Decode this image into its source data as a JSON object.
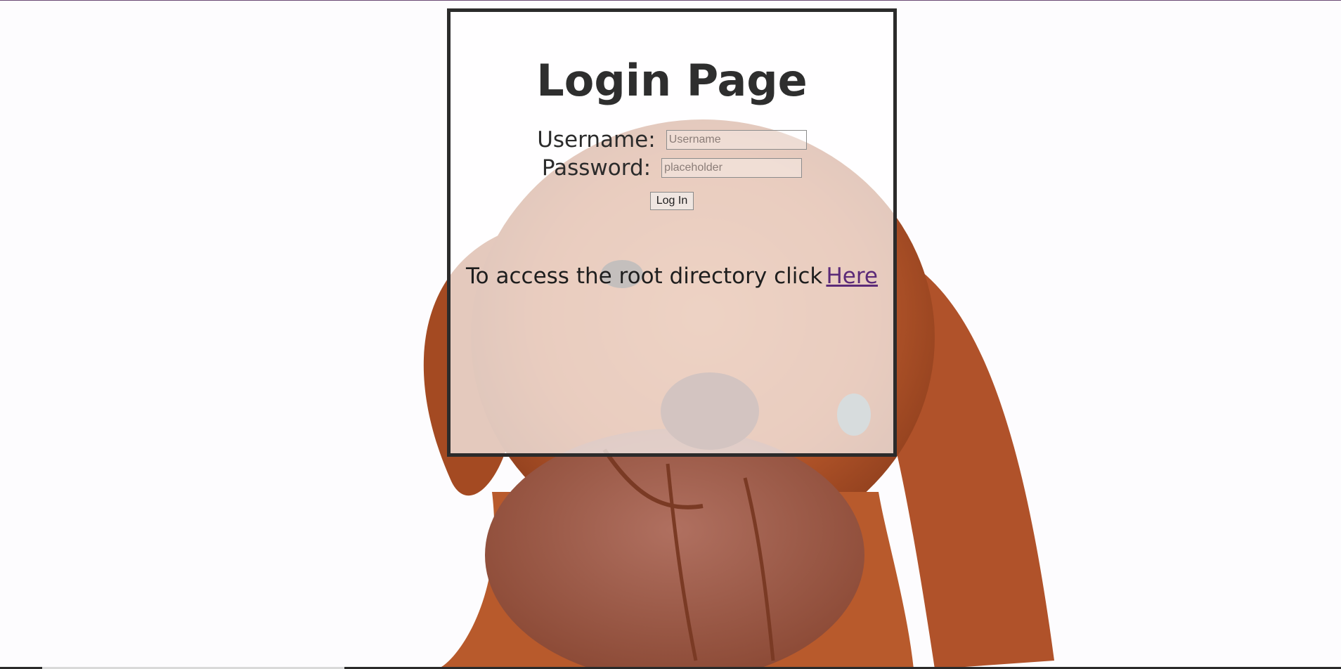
{
  "page": {
    "title": "Login Page"
  },
  "form": {
    "username_label": "Username:",
    "username_placeholder": "Username",
    "password_label": "Password:",
    "password_placeholder": "placeholder",
    "login_button": "Log In"
  },
  "footer_note": {
    "text": "To access the root directory click",
    "link_text": "Here"
  },
  "background": {
    "subject": "puppy-photo",
    "colors": {
      "fur": "#b5562a",
      "fur_dark": "#8a3c1c",
      "backdrop": "#fdfcfe"
    }
  },
  "colors": {
    "border": "#2b2b2b",
    "link": "#5b2a78",
    "text": "#2e2e2e"
  }
}
